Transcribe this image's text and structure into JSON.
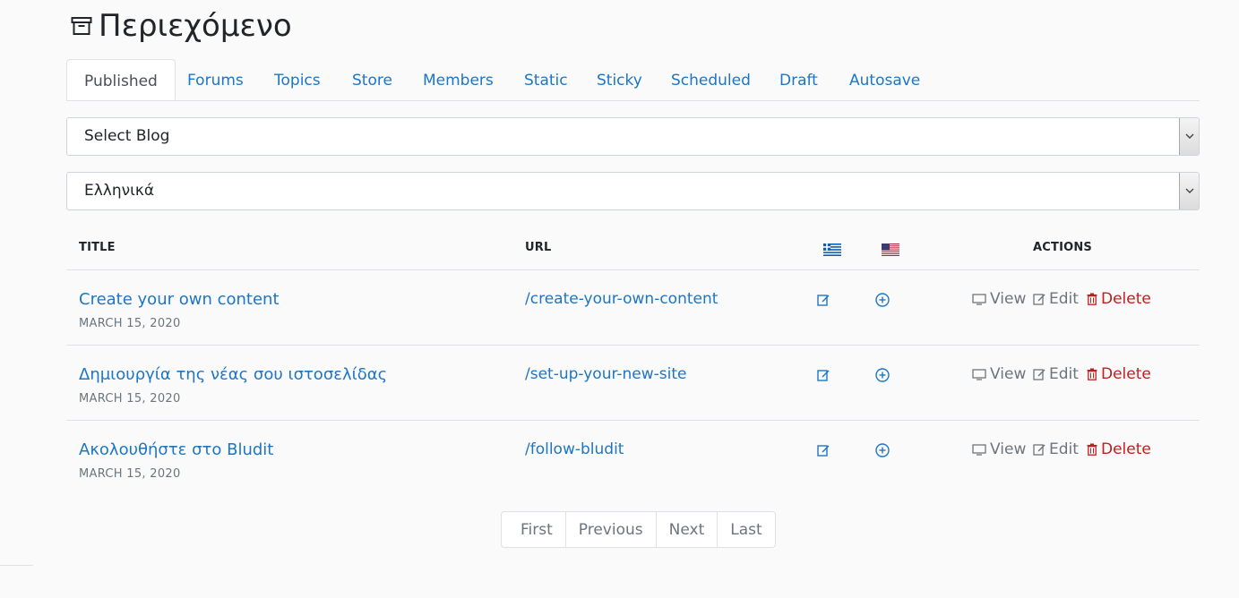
{
  "page": {
    "title": "Περιεχόμενο"
  },
  "tabs": [
    "Published",
    "Forums",
    "Topics",
    "Store",
    "Members",
    "Static",
    "Sticky",
    "Scheduled",
    "Draft",
    "Autosave"
  ],
  "filters": {
    "blog_select": "Select Blog",
    "language_select": "Ελληνικά"
  },
  "table": {
    "headers": {
      "title": "TITLE",
      "url": "URL",
      "actions": "ACTIONS"
    },
    "rows": [
      {
        "title": "Create your own content",
        "date": "MARCH 15, 2020",
        "url": "/create-your-own-content"
      },
      {
        "title": "Δημιουργία της νέας σου ιστοσελίδας",
        "date": "MARCH 15, 2020",
        "url": "/set-up-your-new-site"
      },
      {
        "title": "Ακολουθήστε στο Bludit",
        "date": "MARCH 15, 2020",
        "url": "/follow-bludit"
      }
    ],
    "actions": {
      "view": "View",
      "edit": "Edit",
      "delete": "Delete"
    }
  },
  "pagination": {
    "first": "First",
    "previous": "Previous",
    "next": "Next",
    "last": "Last"
  },
  "colors": {
    "link": "#1c76c5",
    "muted": "#6c757d",
    "danger": "#c21d1d"
  }
}
